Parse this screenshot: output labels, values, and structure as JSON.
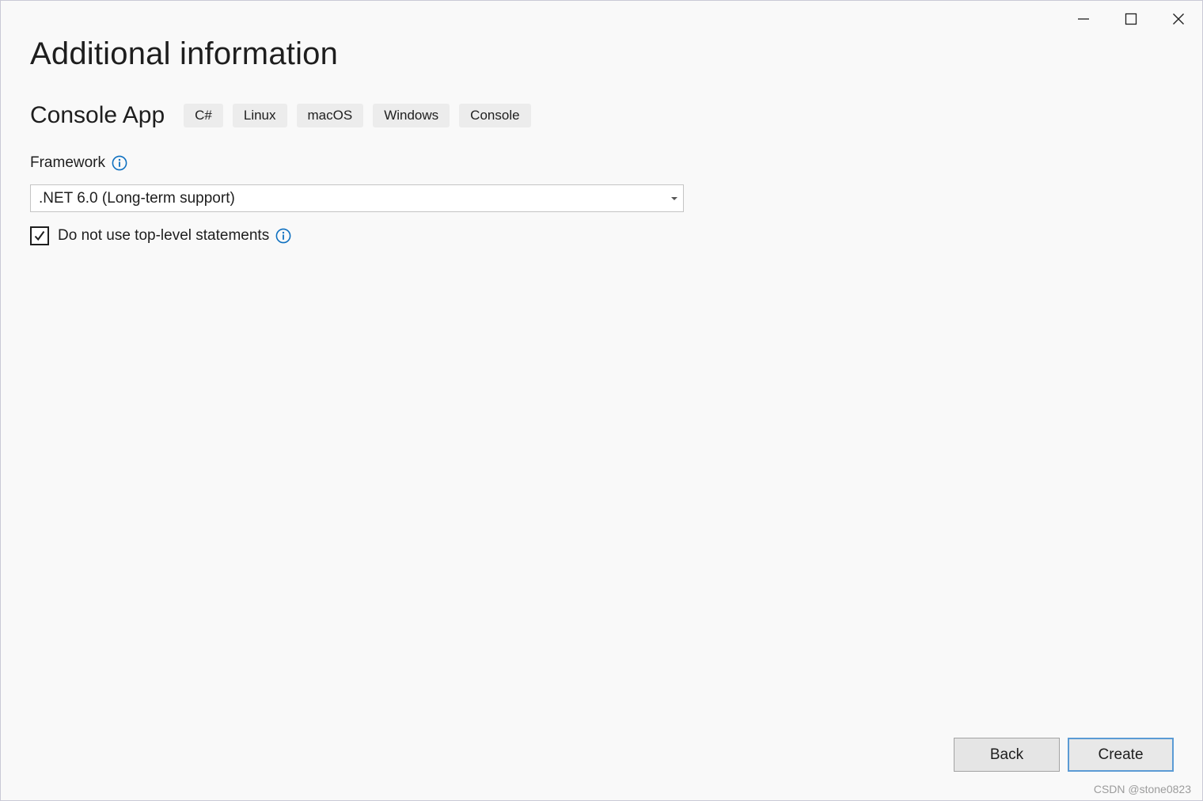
{
  "window": {
    "controls": {
      "minimize": "minimize-icon",
      "maximize": "maximize-icon",
      "close": "close-icon"
    }
  },
  "page": {
    "title": "Additional information"
  },
  "template": {
    "name": "Console App",
    "tags": [
      "C#",
      "Linux",
      "macOS",
      "Windows",
      "Console"
    ]
  },
  "framework": {
    "label": "Framework",
    "selected": ".NET 6.0 (Long-term support)"
  },
  "options": {
    "top_level_statements": {
      "label": "Do not use top-level statements",
      "checked": true
    }
  },
  "buttons": {
    "back": "Back",
    "create": "Create"
  },
  "watermark": "CSDN @stone0823",
  "colors": {
    "info_icon": "#0e70c0",
    "primary_border": "#5b9bd5",
    "background": "#f9f9f9"
  }
}
